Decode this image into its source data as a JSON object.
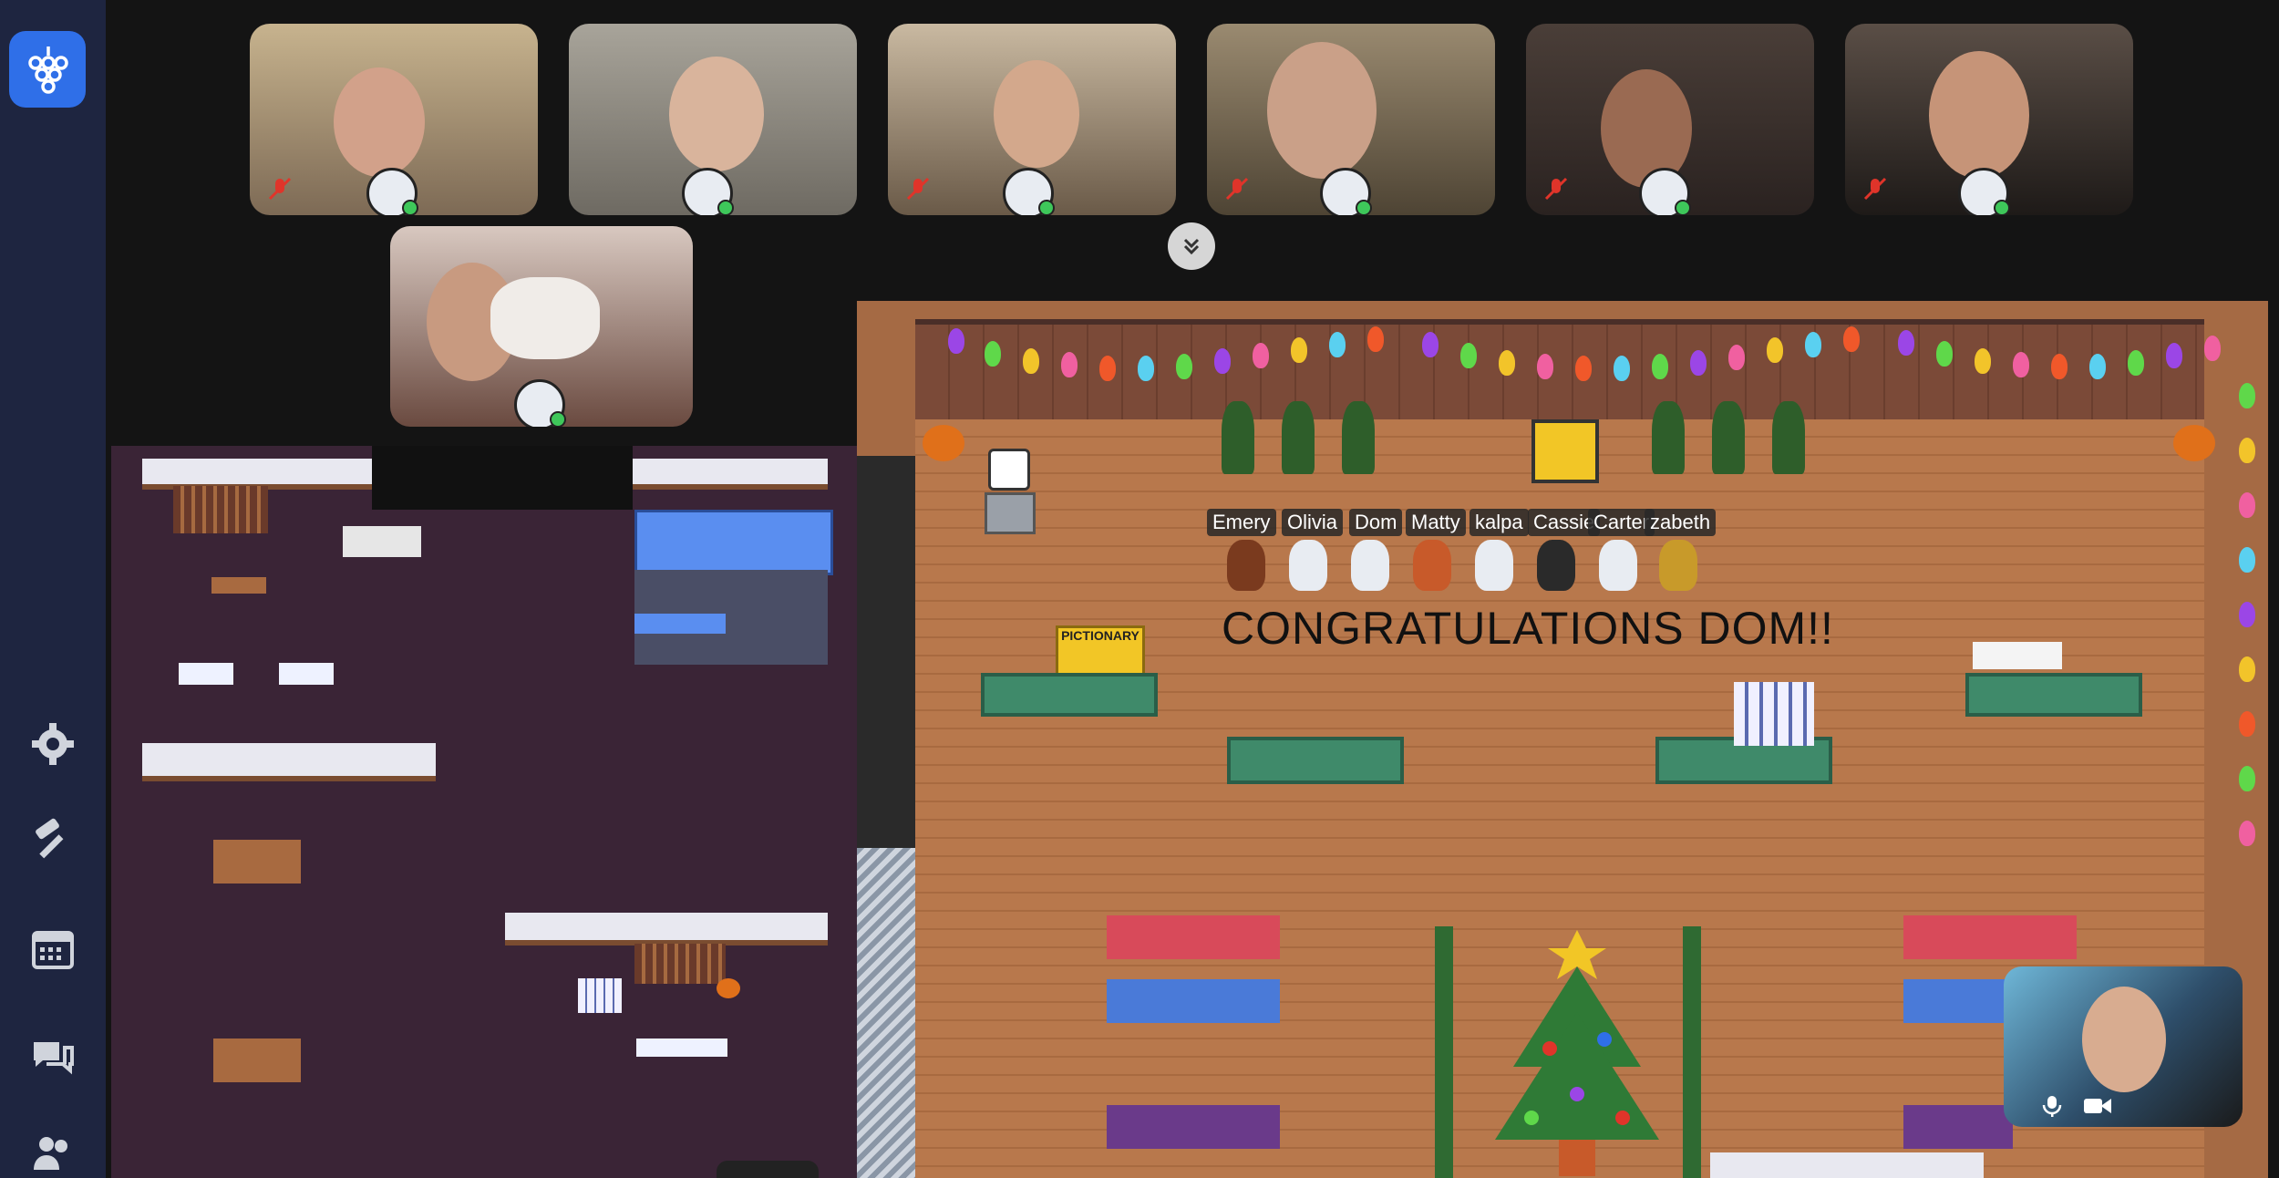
{
  "sidebar": {
    "items": [
      {
        "icon": "gear-icon"
      },
      {
        "icon": "hammer-icon"
      },
      {
        "icon": "calendar-icon"
      },
      {
        "icon": "chat-icon"
      },
      {
        "icon": "people-icon"
      }
    ]
  },
  "participants": [
    {
      "muted": true
    },
    {
      "muted": false
    },
    {
      "muted": true
    },
    {
      "muted": true
    },
    {
      "muted": true
    },
    {
      "muted": true
    },
    {
      "muted": false
    }
  ],
  "map": {
    "names": [
      "Emery",
      "Olivia",
      "Dom",
      "Matty",
      "kalpa",
      "Cassie",
      "Carter",
      "zabeth"
    ],
    "banner": "CONGRATULATIONS DOM!!",
    "sign": "PICTIONARY"
  },
  "colors": {
    "sidebar": "#1e2540",
    "accent": "#2f6fe8",
    "online": "#3ec75a"
  }
}
